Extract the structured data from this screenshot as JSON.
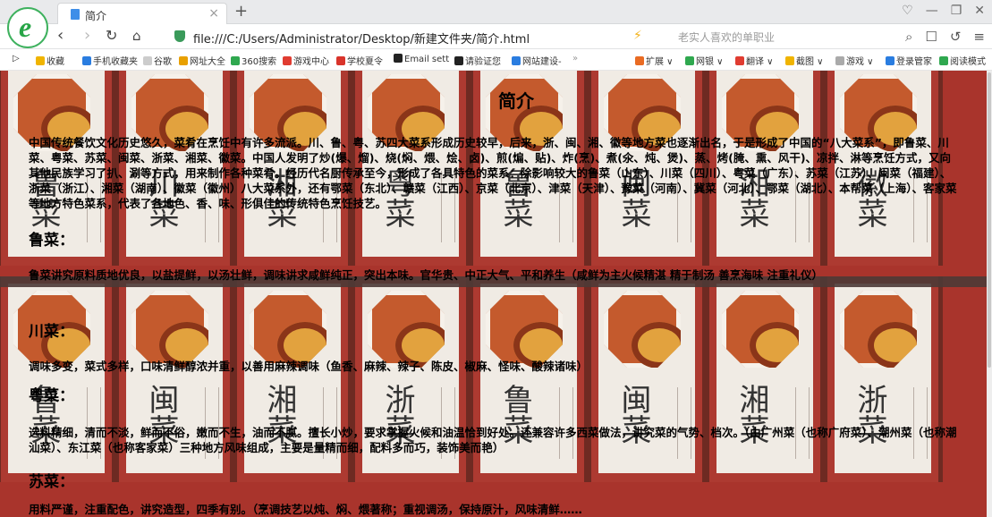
{
  "browser": {
    "tab_title": "简介",
    "address": "file:///C:/Users/Administrator/Desktop/新建文件夹/简介.html",
    "search_hint": "老实人喜欢的单职业",
    "bookmarks": [
      "收藏",
      "手机收藏夹",
      "谷歌",
      "网址大全",
      "360搜索",
      "游戏中心",
      "学校夏令",
      "Email sett",
      "请验证您",
      "网站建设-"
    ],
    "tools": [
      "扩展",
      "网银",
      "翻译",
      "截图",
      "游戏",
      "登录管家",
      "阅读模式"
    ]
  },
  "page": {
    "title": "简介",
    "intro": "中国传统餐饮文化历史悠久，菜肴在烹饪中有许多流派。川、鲁、粤、苏四大菜系形成历史较早，后来，浙、闽、湘、徽等地方菜也逐渐出名，于是形成了中国的“八大菜系”，即鲁菜、川菜、粤菜、苏菜、闽菜、浙菜、湘菜、徽菜。中国人发明了炒(爆、熘)、烧(焖、煨、烩、卤)、煎(煸、贴)、炸(烹)、煮(氽、炖、煲)、蒸、烤(腌、熏、风干)、凉拌、淋等烹饪方式，又向其他民族学习了扒、涮等方式，用来制作各种菜肴。经历代名厨传承至今，形成了各具特色的菜系：除影响较大的鲁菜（山东）、川菜（四川）、粤菜（广东）、苏菜（江苏）、闽菜（福建）、浙菜（浙江）、湘菜（湖南）、徽菜（徽州）八大菜系外，还有鄂菜（东北）、赣菜（江西）、京菜（北京）、津菜（天津）、豫菜（河南）、冀菜（河北）、鄂菜（湖北）、本帮菜（上海）、客家菜等地方特色菜系，代表了各地色、香、味、形俱佳的传统特色烹饪技艺。",
    "sections": [
      {
        "heading": "鲁菜：",
        "text": "鲁菜讲究原料质地优良，以盐提鲜，以汤壮鲜，调味讲求咸鲜纯正，突出本味。官华贵、中正大气、平和养生（咸鲜为主火候精湛 精于制汤 善烹海味 注重礼仪）"
      },
      {
        "heading": "川菜：",
        "text": "调味多变，菜式多样，口味清鲜醇浓并重，以善用麻辣调味（鱼香、麻辣、辣子、陈皮、椒麻、怪味、酸辣诸味）"
      },
      {
        "heading": "粤菜：",
        "text": "选料精细，清而不淡，鲜而不俗，嫩而不生，油而不腻。擅长小炒，要求掌握火候和油温恰到好处。还兼容许多西菜做法，讲究菜的气势、档次。（由广州菜（也称广府菜）、潮州菜（也称潮汕菜）、东江菜（也称客家菜）三种地方风味组成，主要是量精而细，配料多而巧，装饰美而艳）"
      },
      {
        "heading": "苏菜：",
        "text": "用料严谨，注重配色，讲究造型，四季有别。（烹调技艺以炖、焖、煨著称；重视调汤，保持原汁，风味清鲜……"
      }
    ],
    "bg_dishes_top": [
      "鲁菜",
      "川菜",
      "湘菜",
      "粤菜",
      "鲁菜",
      "闽菜",
      "湘菜",
      "徽菜"
    ],
    "bg_dishes_bottom": [
      "鲁菜",
      "闽菜",
      "湘菜",
      "浙菜",
      "鲁菜",
      "闽菜",
      "湘菜",
      "浙菜"
    ]
  }
}
